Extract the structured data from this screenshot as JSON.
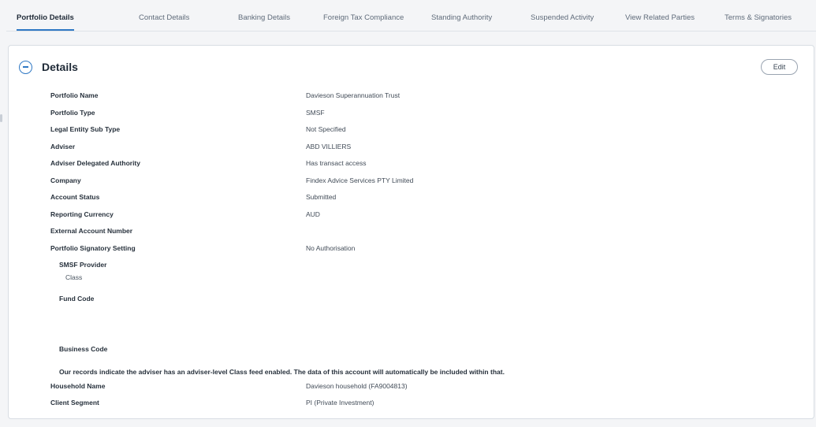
{
  "tabs": [
    {
      "label": "Portfolio Details",
      "active": true
    },
    {
      "label": "Contact Details",
      "active": false
    },
    {
      "label": "Banking Details",
      "active": false
    },
    {
      "label": "Foreign Tax Compliance",
      "active": false
    },
    {
      "label": "Standing Authority",
      "active": false
    },
    {
      "label": "Suspended Activity",
      "active": false
    },
    {
      "label": "View Related Parties",
      "active": false
    },
    {
      "label": "Terms & Signatories",
      "active": false
    }
  ],
  "details": {
    "title": "Details",
    "edit_label": "Edit",
    "collapse_icon": "minus-circle-icon",
    "fields": [
      {
        "label": "Portfolio Name",
        "value": "Davieson Superannuation Trust"
      },
      {
        "label": "Portfolio Type",
        "value": "SMSF"
      },
      {
        "label": "Legal Entity Sub Type",
        "value": "Not Specified"
      },
      {
        "label": "Adviser",
        "value": "ABD VILLIERS"
      },
      {
        "label": "Adviser Delegated Authority",
        "value": "Has transact access"
      },
      {
        "label": "Company",
        "value": "Findex Advice Services PTY Limited"
      },
      {
        "label": "Account Status",
        "value": "Submitted"
      },
      {
        "label": "Reporting Currency",
        "value": "AUD"
      },
      {
        "label": "External Account Number",
        "value": ""
      },
      {
        "label": "Portfolio Signatory Setting",
        "value": "No Authorisation"
      }
    ],
    "smsf": {
      "provider_label": "SMSF Provider",
      "provider_value": "Class",
      "fund_code_label": "Fund Code",
      "business_code_label": "Business Code",
      "notice": "Our records indicate the adviser has an adviser-level Class feed enabled. The data of this account will automatically be included within that."
    },
    "fields_after": [
      {
        "label": "Household Name",
        "value": "Davieson household (FA9004813)"
      },
      {
        "label": "Client Segment",
        "value": "PI (Private Investment)"
      }
    ]
  },
  "colors": {
    "accent": "#2f78c4",
    "background": "#f4f5f7",
    "card": "#ffffff"
  }
}
